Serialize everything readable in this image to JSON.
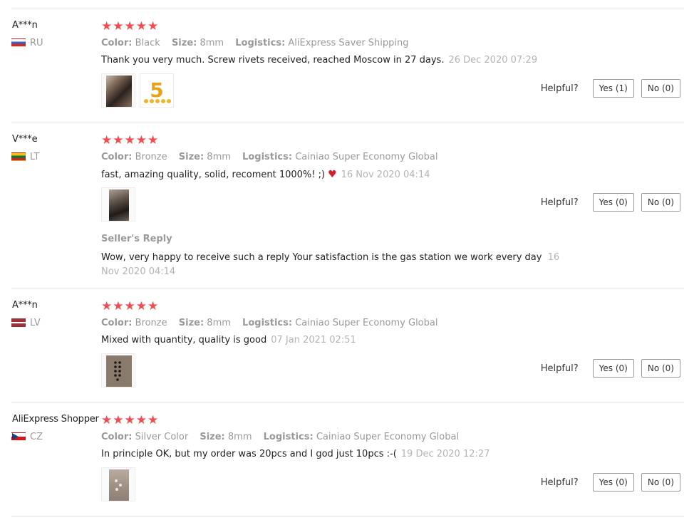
{
  "labels": {
    "color": "Color:",
    "size": "Size:",
    "logistics": "Logistics:",
    "helpful": "Helpful?",
    "seller_reply_title": "Seller's Reply"
  },
  "star_char": "★",
  "reviews": [
    {
      "user": "A***n",
      "country": "RU",
      "flag_colors": [
        "#ffffff",
        "#3b5ec7",
        "#d52b1e"
      ],
      "rating": 5,
      "color": "Black",
      "size": "8mm",
      "logistics": "AliExpress Saver Shipping",
      "text": "Thank you very much. Screw rivets received, reached Moscow in 27 days.",
      "date": "26 Dec 2020 07:29",
      "yes": "Yes (1)",
      "no": "No (0)",
      "photos": [
        "screw-rivets-photo",
        "five-star-graphic"
      ],
      "photo_badge": "5"
    },
    {
      "user": "V***e",
      "country": "LT",
      "flag_colors": [
        "#f8c300",
        "#007a3d",
        "#c1272d"
      ],
      "rating": 5,
      "color": "Bronze",
      "size": "8mm",
      "logistics": "Cainiao Super Economy Global",
      "text": "fast, amazing quality, solid, recoment 1000%! ;)",
      "date": "16 Nov 2020 04:14",
      "yes": "Yes (0)",
      "no": "No (0)",
      "photos": [
        "bronze-rivet-photo"
      ],
      "seller_reply": "Wow, very happy to receive such a reply Your satisfaction is the gas station we work every day",
      "seller_reply_date": "16 Nov 2020 04:14"
    },
    {
      "user": "A***n",
      "country": "LV",
      "flag_colors": [
        "#9e3039",
        "#ffffff",
        "#9e3039"
      ],
      "rating": 5,
      "color": "Bronze",
      "size": "8mm",
      "logistics": "Cainiao Super Economy Global",
      "text": "Mixed with quantity, quality is good",
      "date": "07 Jan 2021 02:51",
      "yes": "Yes (0)",
      "no": "No (0)",
      "photos": [
        "rivets-on-card-photo"
      ]
    },
    {
      "user": "AliExpress Shopper",
      "country": "CZ",
      "flag_colors": [
        "#ffffff",
        "#d7141a",
        "#11457e"
      ],
      "rating": 5,
      "color": "Silver Color",
      "size": "8mm",
      "logistics": "Cainiao Super Economy Global",
      "text": "In principle OK, but my order was 20pcs and I god just 10pcs :-(",
      "date": "19 Dec 2020 12:27",
      "yes": "Yes (0)",
      "no": "No (0)",
      "photos": [
        "silver-rivets-photo"
      ]
    }
  ]
}
